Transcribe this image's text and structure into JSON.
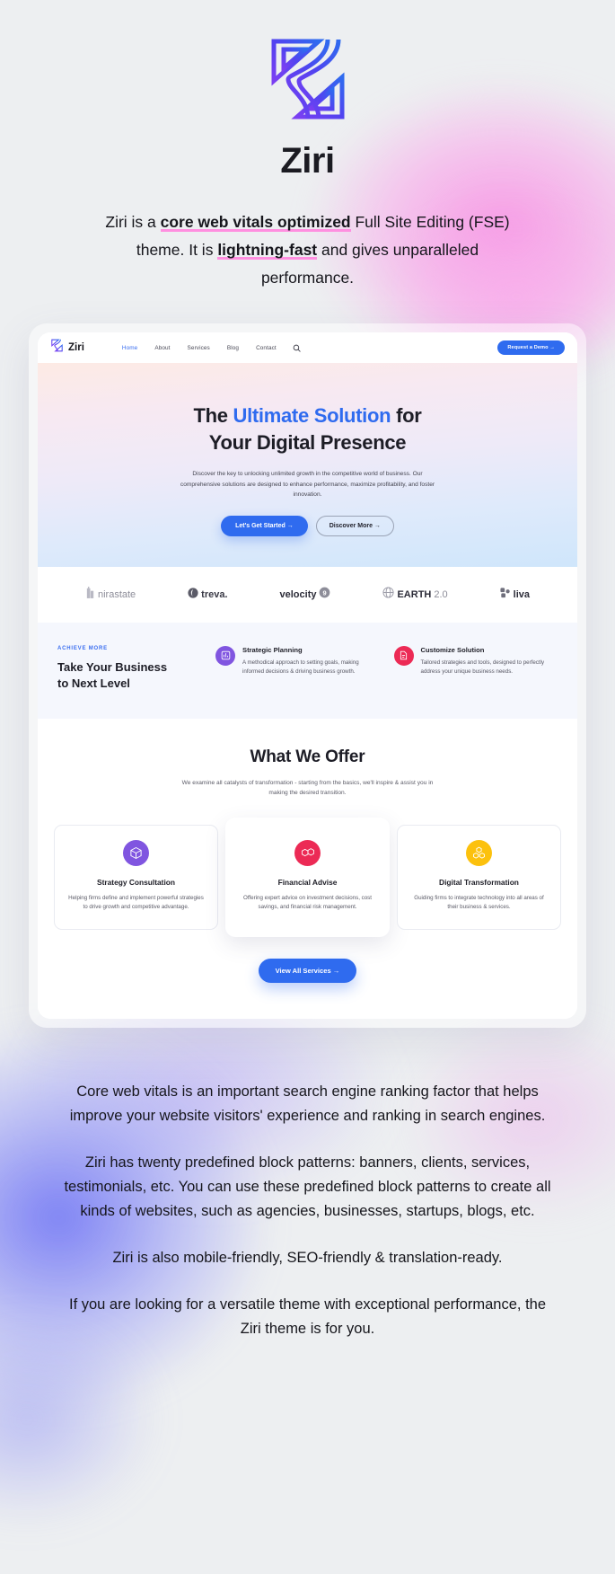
{
  "brand": {
    "name": "Ziri",
    "logo_icon": "ziri-z-logo"
  },
  "intro": {
    "part1": "Ziri is a ",
    "hl1": "core web vitals optimized",
    "part2": " Full Site Editing (FSE) theme. It is ",
    "hl2": "lightning-fast",
    "part3": " and gives unparalleled performance."
  },
  "mock": {
    "nav": {
      "brand": "Ziri",
      "links": [
        {
          "label": "Home",
          "active": true
        },
        {
          "label": "About",
          "active": false
        },
        {
          "label": "Services",
          "active": false
        },
        {
          "label": "Blog",
          "active": false
        },
        {
          "label": "Contact",
          "active": false
        }
      ],
      "search_icon": "search-icon",
      "cta": "Request a Demo  →"
    },
    "hero": {
      "title_a": "The ",
      "title_accent": "Ultimate Solution",
      "title_b": " for",
      "title_line2": "Your Digital Presence",
      "paragraph": "Discover the key to unlocking unlimited growth in the competitive world of business. Our comprehensive solutions are designed to enhance performance, maximize profitability, and foster innovation.",
      "btn_primary": "Let's Get Started  →",
      "btn_outline": "Discover More  →"
    },
    "clients": [
      {
        "name": "nirastate",
        "icon": "building-icon",
        "style": "light"
      },
      {
        "name": "treva.",
        "icon": "leaf-circle-icon",
        "style": "bold"
      },
      {
        "name": "velocity",
        "icon": "nine-badge-icon",
        "style": "dark"
      },
      {
        "name": "EARTH",
        "suffix": "2.0",
        "icon": "globe-icon",
        "style": "dark"
      },
      {
        "name": "liva",
        "icon": "clover-icon",
        "style": "dark"
      }
    ],
    "achieve": {
      "kicker": "ACHIEVE MORE",
      "title_line1": "Take Your Business",
      "title_line2": "to Next Level",
      "features": [
        {
          "title": "Strategic Planning",
          "desc": "A methodical approach to setting goals, making informed decisions & driving business growth.",
          "icon": "chart-square-icon",
          "color": "#8055e0"
        },
        {
          "title": "Customize Solution",
          "desc": "Tailored strategies and tools, designed to perfectly address your unique business needs.",
          "icon": "document-edit-icon",
          "color": "#ec2a55"
        }
      ]
    },
    "offer": {
      "title": "What We Offer",
      "subtitle": "We examine all catalysts of transformation - starting from the basics, we'll inspire & assist you in making the desired transition.",
      "cards": [
        {
          "title": "Strategy Consultation",
          "desc": "Helping firms define and implement powerful strategies to drive growth and competitive advantage.",
          "icon": "cube-icon",
          "color": "#8055e0",
          "featured": false
        },
        {
          "title": "Financial Advise",
          "desc": "Offering expert advice on investment decisions, cost savings, and financial risk management.",
          "icon": "dual-cube-icon",
          "color": "#ec2a55",
          "featured": true
        },
        {
          "title": "Digital Transformation",
          "desc": "Guiding firms to integrate technology into all areas of their business & services.",
          "icon": "cube-stack-icon",
          "color": "#fcc10d",
          "featured": false
        }
      ],
      "view_all": "View All Services  →"
    }
  },
  "bottom": {
    "paragraphs": [
      "Core web vitals is an important search engine ranking factor that helps improve your website visitors' experience and ranking in search engines.",
      "Ziri has twenty predefined block patterns: banners, clients, services, testimonials, etc. You can use these predefined block patterns to create all kinds of websites, such as agencies, businesses, startups, blogs, etc.",
      "Ziri is also mobile-friendly, SEO-friendly & translation-ready.",
      "If you are looking for a versatile theme with exceptional performance, the Ziri theme is for you."
    ]
  },
  "colors": {
    "accent_blue": "#2f6bef",
    "highlight_pink": "#ff8fe0",
    "purple": "#8055e0",
    "red": "#ec2a55",
    "yellow": "#fcc10d"
  }
}
